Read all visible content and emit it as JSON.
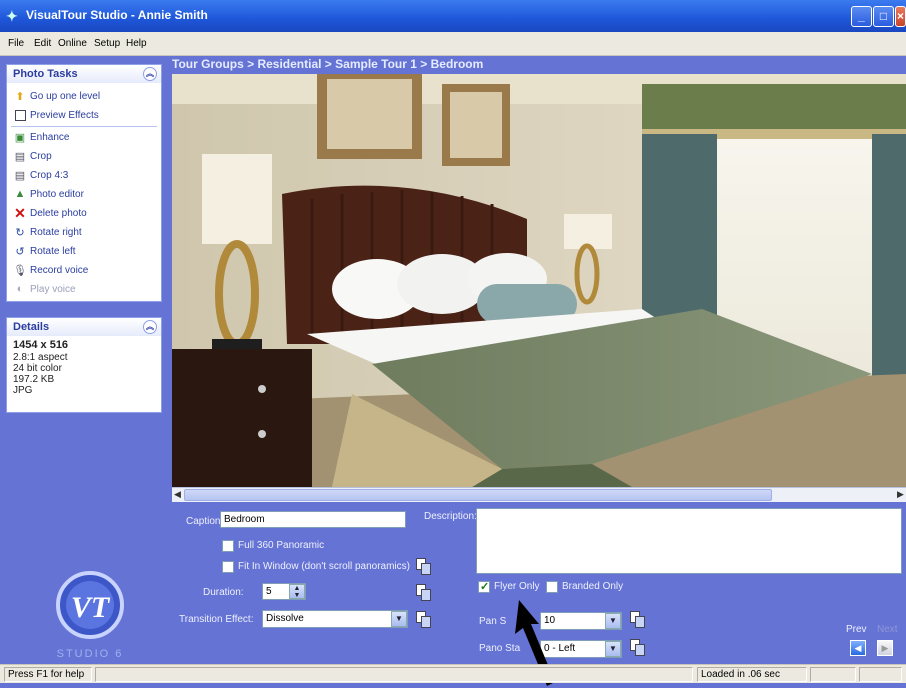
{
  "window": {
    "title": "VisualTour Studio - Annie Smith"
  },
  "menu": [
    "File",
    "Edit",
    "Online",
    "Setup",
    "Help"
  ],
  "breadcrumb": "Tour Groups > Residential > Sample Tour 1 > Bedroom",
  "photo_tasks": {
    "title": "Photo Tasks",
    "items": [
      {
        "label": "Go up one level",
        "icon": "up-arrow-icon"
      },
      {
        "label": "Preview Effects",
        "icon": "checkbox-icon"
      },
      {
        "label": "Enhance",
        "icon": "enhance-icon"
      },
      {
        "label": "Crop",
        "icon": "crop-icon"
      },
      {
        "label": "Crop 4:3",
        "icon": "crop-icon"
      },
      {
        "label": "Photo editor",
        "icon": "photo-editor-icon"
      },
      {
        "label": "Delete photo",
        "icon": "delete-icon"
      },
      {
        "label": "Rotate right",
        "icon": "rotate-right-icon"
      },
      {
        "label": "Rotate left",
        "icon": "rotate-left-icon"
      },
      {
        "label": "Record voice",
        "icon": "microphone-icon"
      },
      {
        "label": "Play voice",
        "icon": "speaker-icon",
        "disabled": true
      }
    ]
  },
  "details": {
    "title": "Details",
    "resolution": "1454 x 516",
    "aspect": "2.8:1 aspect",
    "color": "24 bit color",
    "size": "197.2 KB",
    "format": "JPG"
  },
  "form": {
    "caption_label": "Caption:",
    "caption_value": "Bedroom",
    "full360_label": "Full 360 Panoramic",
    "fitwindow_label": "Fit In Window (don't scroll panoramics)",
    "duration_label": "Duration:",
    "duration_value": "5",
    "transition_label": "Transition Effect:",
    "transition_value": "Dissolve",
    "description_label": "Description:",
    "description_value": "",
    "flyer_only_label": "Flyer Only",
    "flyer_only_checked": true,
    "branded_only_label": "Branded Only",
    "branded_only_checked": false,
    "pan_speed_label": "Pan S",
    "pan_speed_value": "10",
    "pano_start_label": "Pano Sta",
    "pano_start_value": "0 - Left"
  },
  "nav": {
    "prev_label": "Prev",
    "next_label": "Next"
  },
  "logo": {
    "text": "STUDIO 6"
  },
  "status": {
    "help": "Press F1 for help",
    "loaded": "Loaded in .06 sec"
  },
  "colors": {
    "background": "#6573d4",
    "titlebar": "#1e56d8",
    "panel_header_text": "#2a3d9f"
  }
}
